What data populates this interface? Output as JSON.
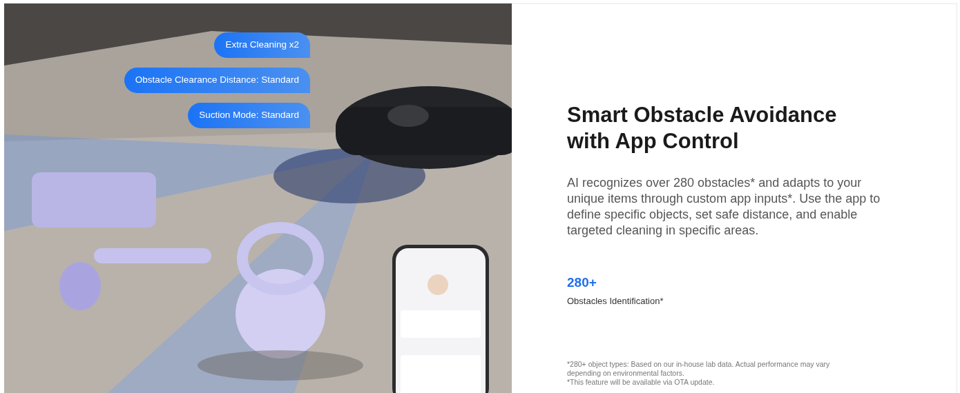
{
  "bubbles": [
    "Extra Cleaning x2",
    "Obstacle Clearance Distance: Standard",
    "Suction Mode: Standard"
  ],
  "heading": "Smart Obstacle Avoidance with App Control",
  "description": "AI recognizes over 280 obstacles* and adapts to your unique items through custom app inputs*. Use the app to define specific objects, set safe distance, and enable targeted cleaning in specific areas.",
  "stat": {
    "value": "280+",
    "label": "Obstacles Identification*"
  },
  "footnotes": [
    "*280+ object types: Based on our in-house lab data. Actual performance may vary depending on environmental factors.",
    "*This feature will be available via OTA update."
  ]
}
